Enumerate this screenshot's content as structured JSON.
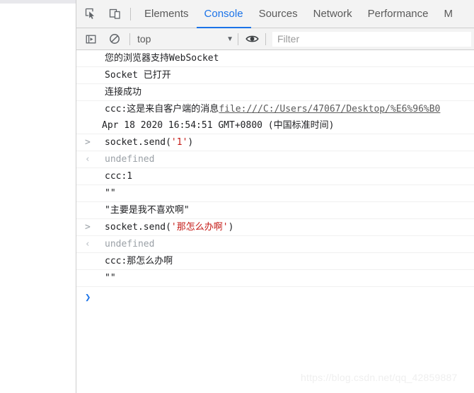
{
  "devtools": {
    "toolbar_icons": [
      {
        "name": "inspect-element-icon",
        "label": "Inspect element"
      },
      {
        "name": "device-toolbar-icon",
        "label": "Toggle device toolbar"
      }
    ],
    "tabs": [
      {
        "label": "Elements",
        "active": false
      },
      {
        "label": "Console",
        "active": true
      },
      {
        "label": "Sources",
        "active": false
      },
      {
        "label": "Network",
        "active": false
      },
      {
        "label": "Performance",
        "active": false
      },
      {
        "label": "M",
        "active": false
      }
    ]
  },
  "console_toolbar": {
    "sidebar_toggle_icon": "show-console-sidebar-icon",
    "clear_icon": "clear-console-icon",
    "context_value": "top",
    "context_caret": "▼",
    "eye_icon": "live-expressions-eye-icon",
    "filter_placeholder": "Filter"
  },
  "console_log": {
    "rows": [
      {
        "gutter": "",
        "gutter_type": "none",
        "text": "您的浏览器支持WebSocket"
      },
      {
        "gutter": "",
        "gutter_type": "none",
        "text": "Socket 已打开"
      },
      {
        "gutter": "",
        "gutter_type": "none",
        "text": "连接成功"
      },
      {
        "gutter": "",
        "gutter_type": "none",
        "text": "ccc:这是来自客户端的消息",
        "link": "file:///C:/Users/47067/Desktop/%E6%96%B0",
        "second_line": "Apr 18 2020 16:54:51 GMT+0800 (中国标准时间)"
      },
      {
        "gutter": ">",
        "gutter_type": "input",
        "code_prefix": "socket.send(",
        "code_string": "'1'",
        "code_suffix": ")"
      },
      {
        "gutter": "‹",
        "gutter_type": "output",
        "text": "undefined",
        "dim": true
      },
      {
        "gutter": "",
        "gutter_type": "none",
        "text": "ccc:1"
      },
      {
        "gutter": "",
        "gutter_type": "none",
        "text": "\"\""
      },
      {
        "gutter": "",
        "gutter_type": "none",
        "text": "\"主要是我不喜欢啊\""
      },
      {
        "gutter": ">",
        "gutter_type": "input",
        "code_prefix": "socket.send(",
        "code_string": "'那怎么办啊'",
        "code_suffix": ")"
      },
      {
        "gutter": "‹",
        "gutter_type": "output",
        "text": "undefined",
        "dim": true
      },
      {
        "gutter": "",
        "gutter_type": "none",
        "text": "ccc:那怎么办啊"
      },
      {
        "gutter": "",
        "gutter_type": "none",
        "text": "\"\""
      }
    ],
    "prompt_arrow": "❯"
  },
  "watermark": {
    "text": "https://blog.csdn.net/qq_42859887"
  },
  "colors": {
    "accent": "#1b73e8",
    "string_literal": "#c41a16",
    "toolbar_bg": "#f3f3f3",
    "border": "#cdcdcd",
    "row_border": "#f0f0f0",
    "dim_text": "#9aa0a6"
  }
}
